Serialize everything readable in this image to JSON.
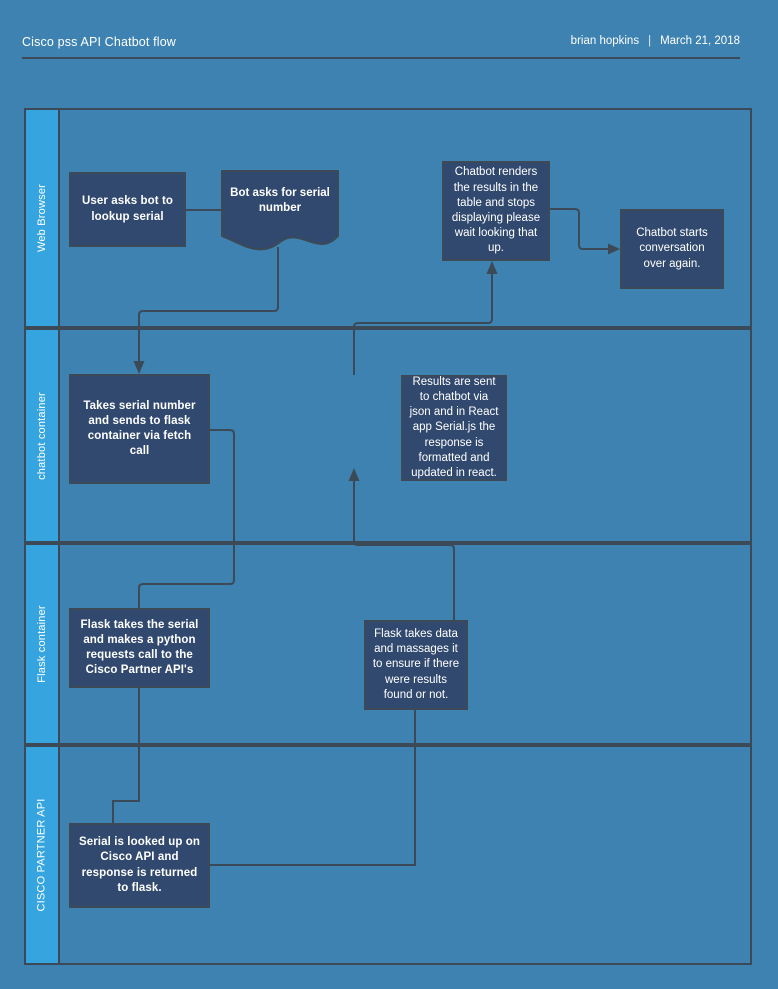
{
  "header": {
    "title": "Cisco pss API Chatbot flow",
    "author": "brian hopkins",
    "separator": "|",
    "date": "March 21, 2018"
  },
  "colors": {
    "page_background": "#3d82b0",
    "lane_header": "#36a5df",
    "node_fill": "#31496e",
    "stroke": "#3c4a58",
    "text": "#ffffff"
  },
  "lanes": [
    {
      "id": "web-browser",
      "label": "Web Browser"
    },
    {
      "id": "chatbot-container",
      "label": "chatbot container"
    },
    {
      "id": "flask-container",
      "label": "Flask container"
    },
    {
      "id": "cisco-partner-api",
      "label": "CISCO PARTNER API"
    }
  ],
  "nodes": [
    {
      "id": "user-asks",
      "lane": "web-browser",
      "text": "User asks bot to lookup serial"
    },
    {
      "id": "bot-asks",
      "lane": "web-browser",
      "text": "Bot asks for serial number"
    },
    {
      "id": "chatbot-renders",
      "lane": "web-browser",
      "text": "Chatbot renders the results in the table and stops displaying please wait looking that up."
    },
    {
      "id": "chatbot-starts-over",
      "lane": "web-browser",
      "text": "Chatbot starts conversation over again."
    },
    {
      "id": "takes-serial",
      "lane": "chatbot-container",
      "text": "Takes serial number and sends to flask container via fetch call"
    },
    {
      "id": "results-sent",
      "lane": "chatbot-container",
      "text": "Results are sent to chatbot via json and in React app Serial.js the response is formatted and updated in react."
    },
    {
      "id": "flask-takes-serial",
      "lane": "flask-container",
      "text": "Flask takes the serial and makes a python requests call to the Cisco Partner API's"
    },
    {
      "id": "flask-massages",
      "lane": "flask-container",
      "text": "Flask takes data and massages it to ensure if there were results found or not."
    },
    {
      "id": "serial-lookup",
      "lane": "cisco-partner-api",
      "text": "Serial is looked up on Cisco API and response is returned to flask."
    }
  ]
}
